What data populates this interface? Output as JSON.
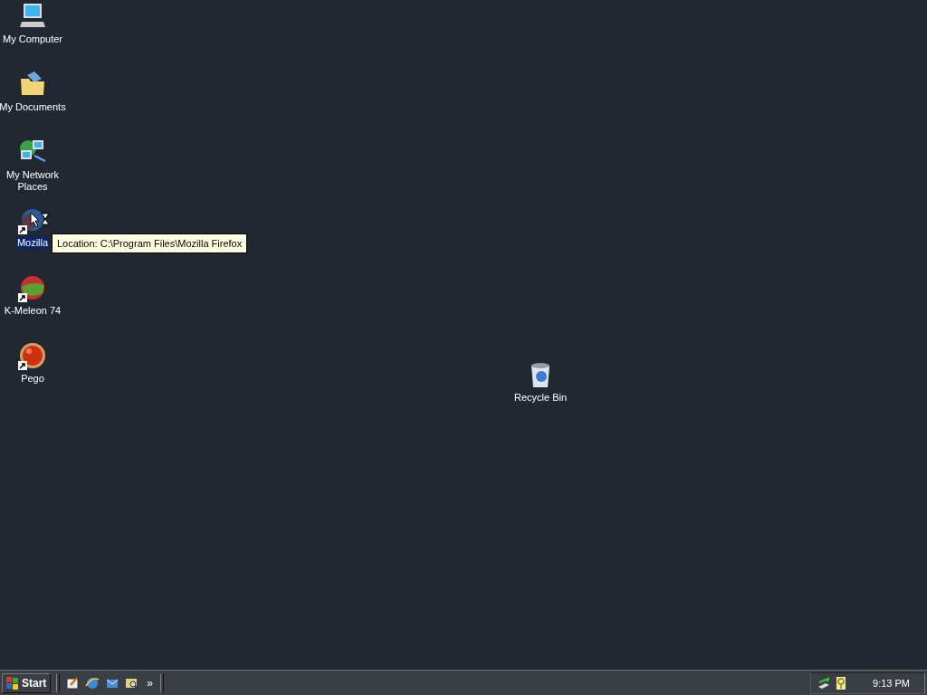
{
  "desktop_icons": [
    {
      "kind": "computer",
      "label": "My Computer",
      "selected": false,
      "shortcut": false
    },
    {
      "kind": "documents",
      "label": "My Documents",
      "selected": false,
      "shortcut": false
    },
    {
      "kind": "network",
      "label": "My Network Places",
      "selected": false,
      "shortcut": false
    },
    {
      "kind": "browser",
      "label": "Mozilla",
      "selected": true,
      "shortcut": true
    },
    {
      "kind": "melon",
      "label": "K-Meleon 74",
      "selected": false,
      "shortcut": true
    },
    {
      "kind": "orb",
      "label": "Pego",
      "selected": false,
      "shortcut": true
    },
    {
      "kind": "bin",
      "label": "Recycle Bin",
      "selected": false,
      "shortcut": false
    }
  ],
  "tooltip": {
    "text": "Location: C:\\Program Files\\Mozilla Firefox"
  },
  "taskbar": {
    "start_label": "Start",
    "quick_launch": [
      {
        "kind": "note"
      },
      {
        "kind": "ie"
      },
      {
        "kind": "mail"
      },
      {
        "kind": "search"
      }
    ],
    "chevron": "»",
    "tray": [
      {
        "kind": "network"
      },
      {
        "kind": "key"
      }
    ],
    "clock": "9:13 PM"
  }
}
